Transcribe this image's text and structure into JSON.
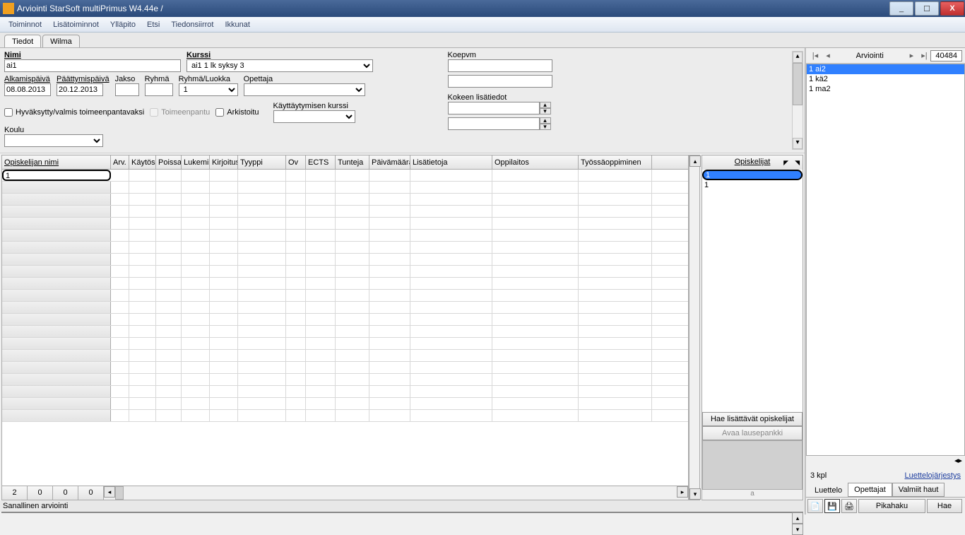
{
  "titlebar": {
    "text": "Arviointi StarSoft multiPrimus W4.44e /"
  },
  "menubar": [
    "Toiminnot",
    "Lisätoiminnot",
    "Ylläpito",
    "Etsi",
    "Tiedonsiirrot",
    "Ikkunat"
  ],
  "tabs": {
    "t1": "Tiedot",
    "t2": "Wilma"
  },
  "form": {
    "nimi_label": "Nimi",
    "nimi_value": "ai1",
    "kurssi_label": "Kurssi",
    "kurssi_value": "ai1  1 lk syksy 3",
    "koepvm_label": "Koepvm",
    "alkamispaiva_label": "Alkamispäivä",
    "alkamispaiva_value": "08.08.2013",
    "paattymispaiva_label": "Päättymispäivä",
    "paattymispaiva_value": "20.12.2013",
    "jakso_label": "Jakso",
    "ryhma_label": "Ryhmä",
    "ryhma_luokka_label": "Ryhmä/Luokka",
    "ryhma_luokka_value": "1",
    "opettaja_label": "Opettaja",
    "kokeen_lisatiedot_label": "Kokeen lisätiedot",
    "hyvaksytty_label": "Hyväksytty/valmis toimeenpantavaksi",
    "toimeenpantu_label": "Toimeenpantu",
    "arkistoitu_label": "Arkistoitu",
    "kayttaytymisen_label": "Käyttäytymisen kurssi",
    "koulu_label": "Koulu"
  },
  "grid": {
    "headers": [
      "Opiskelijan nimi",
      "Arv.",
      "Käytös",
      "Poissa",
      "Lukemin",
      "Kirjoitus",
      "Tyyppi",
      "Ov",
      "ECTS",
      "Tunteja",
      "Päivämäärä",
      "Lisätietoja",
      "Oppilaitos",
      "Työssäoppiminen"
    ],
    "widths": [
      154,
      26,
      38,
      36,
      40,
      40,
      68,
      28,
      42,
      48,
      58,
      116,
      122,
      104
    ],
    "first_cell": "1",
    "footer": [
      "2",
      "0",
      "0",
      "0"
    ]
  },
  "opiskelijat": {
    "header": "Opiskelijat",
    "rows": [
      "1",
      "1"
    ],
    "btn_hae": "Hae lisättävät opiskelijat",
    "btn_avaa": "Avaa lausepankki"
  },
  "sanallinen": {
    "label": "Sanallinen arviointi"
  },
  "right": {
    "nav_title": "Arviointi",
    "record": "40484",
    "courses": [
      "1 ai2",
      "1 kä2",
      "1 ma2"
    ],
    "count": "3 kpl",
    "link": "Luettelojärjestys",
    "tabs": {
      "luettelo": "Luettelo",
      "opettajat": "Opettajat",
      "valmiit": "Valmiit haut"
    },
    "pikahaku": "Pikahaku",
    "hae": "Hae",
    "footer_a": "a"
  }
}
